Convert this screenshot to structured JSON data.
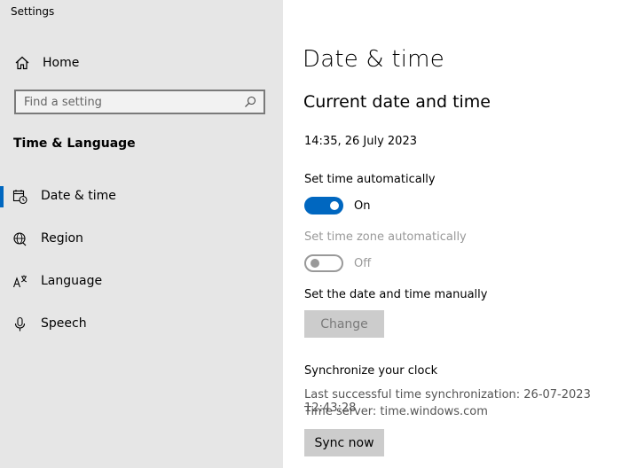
{
  "window": {
    "title": "Settings"
  },
  "sidebar": {
    "home_label": "Home",
    "search_placeholder": "Find a setting",
    "section_title": "Time & Language",
    "items": [
      {
        "label": "Date & time",
        "icon": "calendar-clock-icon",
        "active": true
      },
      {
        "label": "Region",
        "icon": "globe-icon",
        "active": false
      },
      {
        "label": "Language",
        "icon": "language-icon",
        "active": false
      },
      {
        "label": "Speech",
        "icon": "microphone-icon",
        "active": false
      }
    ]
  },
  "main": {
    "page_title": "Date & time",
    "current_section_title": "Current date and time",
    "current_datetime": "14:35, 26 July 2023",
    "set_time_auto": {
      "label": "Set time automatically",
      "state": "On",
      "on": true
    },
    "set_timezone_auto": {
      "label": "Set time zone automatically",
      "state": "Off",
      "on": false,
      "disabled": true
    },
    "manual": {
      "label": "Set the date and time manually",
      "button": "Change",
      "disabled": true
    },
    "sync": {
      "title": "Synchronize your clock",
      "last_sync": "Last successful time synchronization: 26-07-2023 12:43:28",
      "server": "Time server: time.windows.com",
      "button": "Sync now"
    }
  },
  "colors": {
    "accent": "#0067c0",
    "sidebar_bg": "#e6e6e6"
  }
}
